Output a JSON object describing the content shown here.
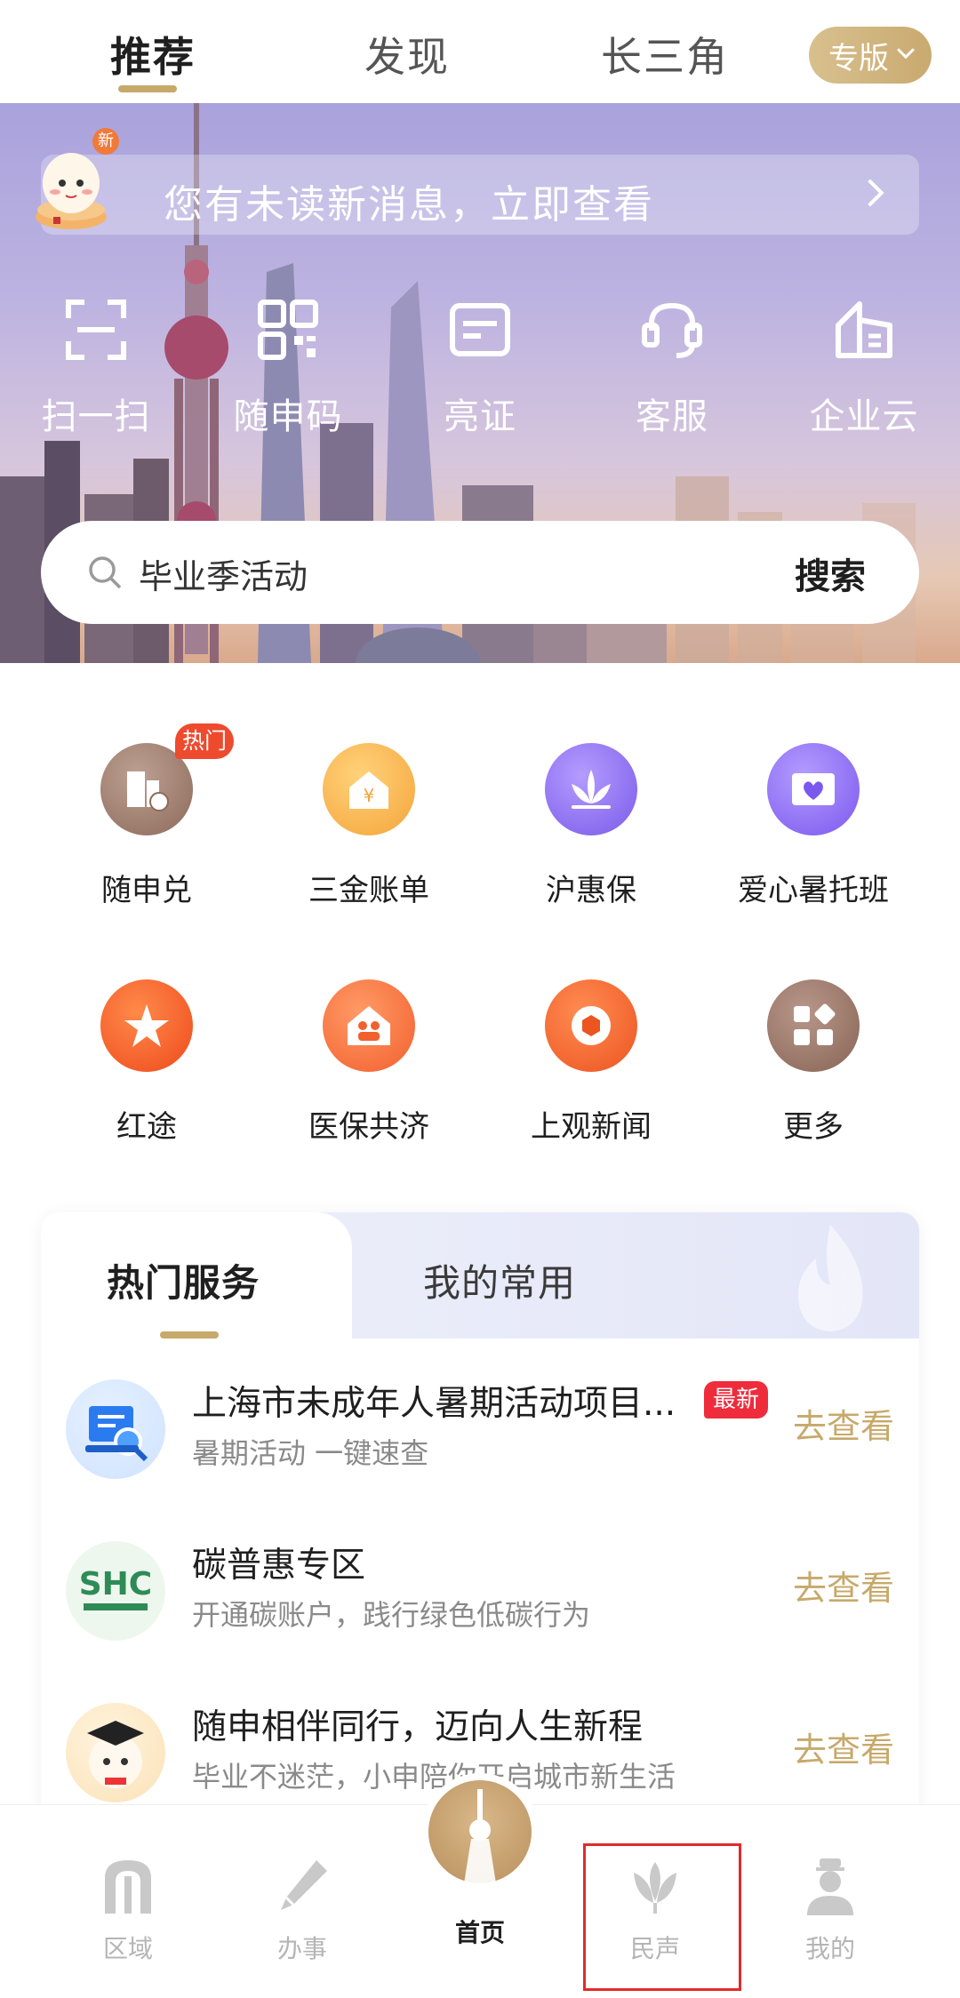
{
  "top_tabs": [
    {
      "label": "推荐",
      "active": true
    },
    {
      "label": "发现",
      "active": false
    },
    {
      "label": "长三角",
      "active": false
    }
  ],
  "version_button": {
    "label": "专版"
  },
  "notice": {
    "text": "您有未读新消息，立即查看",
    "badge": "新"
  },
  "quick_actions": [
    {
      "label": "扫一扫",
      "icon": "scan-icon"
    },
    {
      "label": "随申码",
      "icon": "qr-code-icon"
    },
    {
      "label": "亮证",
      "icon": "id-card-icon"
    },
    {
      "label": "客服",
      "icon": "headset-icon"
    },
    {
      "label": "企业云",
      "icon": "building-icon"
    }
  ],
  "search": {
    "placeholder": "毕业季活动",
    "button": "搜索"
  },
  "services": [
    {
      "label": "随申兑",
      "icon": "building-benefit-icon",
      "color": "#9a7564",
      "badge": "热门"
    },
    {
      "label": "三金账单",
      "icon": "house-yuan-icon",
      "color": "#f7b04a"
    },
    {
      "label": "沪惠保",
      "icon": "lotus-icon",
      "color": "#8b6ef0"
    },
    {
      "label": "爱心暑托班",
      "icon": "heart-book-icon",
      "color": "#8c6cf2"
    },
    {
      "label": "红途",
      "icon": "red-star-icon",
      "color": "#f05a26"
    },
    {
      "label": "医保共济",
      "icon": "family-house-icon",
      "color": "#f46e3c"
    },
    {
      "label": "上观新闻",
      "icon": "shutter-icon",
      "color": "#f0602a"
    },
    {
      "label": "更多",
      "icon": "grid-more-icon",
      "color": "#8e6b5c"
    }
  ],
  "card": {
    "tabs": [
      {
        "label": "热门服务",
        "active": true
      },
      {
        "label": "我的常用",
        "active": false
      }
    ],
    "rows": [
      {
        "title": "上海市未成年人暑期活动项目...",
        "subtitle": "暑期活动  一键速查",
        "badge": "最新",
        "action": "去查看",
        "icon": "document-search-icon"
      },
      {
        "title": "碳普惠专区",
        "subtitle": "开通碳账户，践行绿色低碳行为",
        "action": "去查看",
        "icon": "carbon-logo-icon"
      },
      {
        "title": "随申相伴同行，迈向人生新程",
        "subtitle": "毕业不迷茫，小申陪你开启城市新生活",
        "action": "去查看",
        "icon": "graduate-mascot-icon"
      }
    ]
  },
  "bottom_nav": [
    {
      "label": "区域",
      "icon": "gate-icon",
      "active": false
    },
    {
      "label": "办事",
      "icon": "pen-icon",
      "active": false
    },
    {
      "label": "首页",
      "icon": "tower-icon",
      "active": true
    },
    {
      "label": "民声",
      "icon": "magnolia-icon",
      "active": false
    },
    {
      "label": "我的",
      "icon": "person-icon",
      "active": false
    }
  ],
  "colors": {
    "accent_gold": "#c7a96b",
    "hot_red": "#ee4a2e"
  }
}
